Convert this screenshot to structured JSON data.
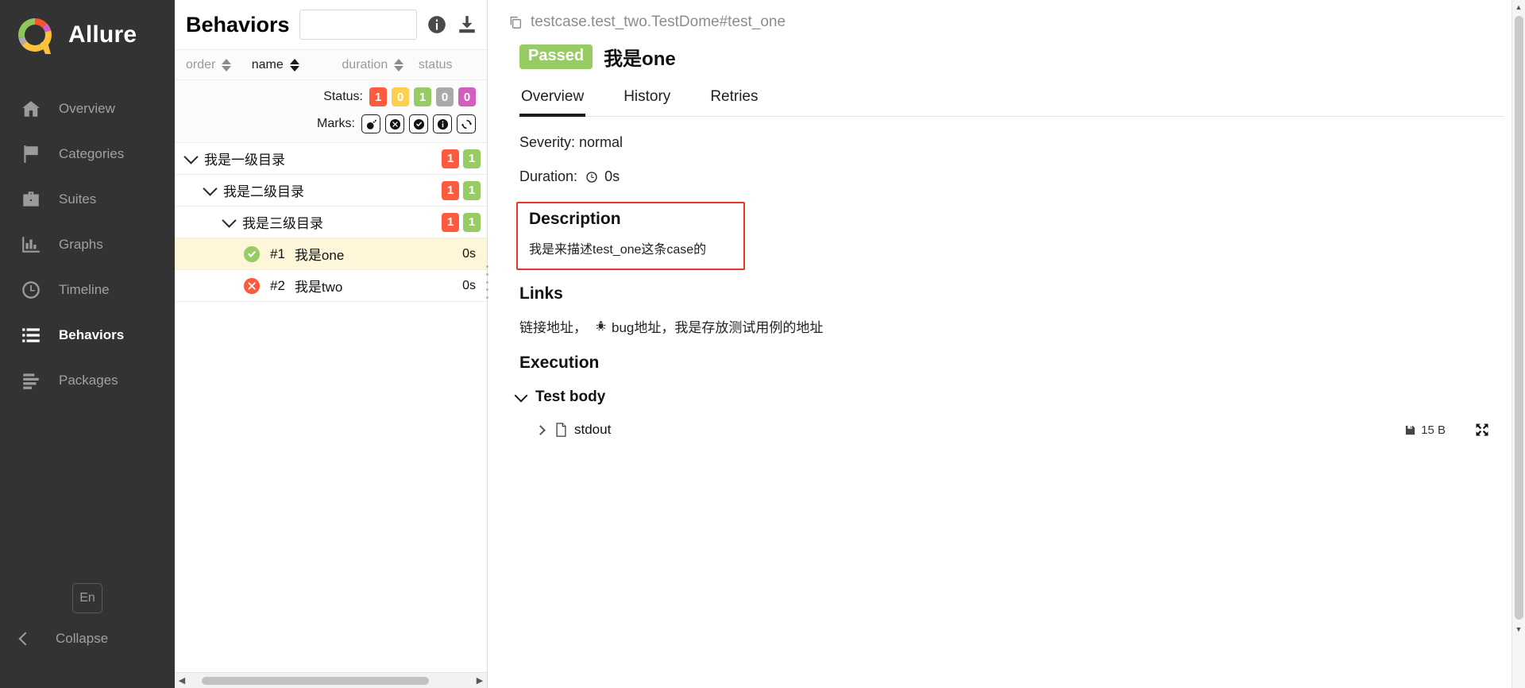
{
  "sidebar": {
    "brand": "Allure",
    "logo_icon": "allure-donut-logo",
    "items": [
      {
        "label": "Overview",
        "icon": "home-icon",
        "active": false
      },
      {
        "label": "Categories",
        "icon": "flag-icon",
        "active": false
      },
      {
        "label": "Suites",
        "icon": "briefcase-icon",
        "active": false
      },
      {
        "label": "Graphs",
        "icon": "bar-chart-icon",
        "active": false
      },
      {
        "label": "Timeline",
        "icon": "clock-icon",
        "active": false
      },
      {
        "label": "Behaviors",
        "icon": "list-icon",
        "active": true
      },
      {
        "label": "Packages",
        "icon": "layers-icon",
        "active": false
      }
    ],
    "language_button": "En",
    "collapse_label": "Collapse",
    "collapse_icon": "chevron-left-icon"
  },
  "tree_panel": {
    "title": "Behaviors",
    "search_value": "",
    "search_placeholder": "",
    "info_icon": "info-circle-icon",
    "download_icon": "download-icon",
    "columns": [
      {
        "label": "order",
        "sorted": false
      },
      {
        "label": "name",
        "sorted": true
      },
      {
        "label": "duration",
        "sorted": false
      },
      {
        "label": "status",
        "sorted": false
      }
    ],
    "status_filter_label": "Status:",
    "status_filters": [
      {
        "value": "1",
        "color": "#fd5a3e",
        "name": "failed"
      },
      {
        "value": "0",
        "color": "#ffd050",
        "name": "broken"
      },
      {
        "value": "1",
        "color": "#97cc64",
        "name": "passed"
      },
      {
        "value": "0",
        "color": "#aaaaaa",
        "name": "skipped"
      },
      {
        "value": "0",
        "color": "#d35ebe",
        "name": "unknown"
      }
    ],
    "marks_label": "Marks:",
    "marks": [
      {
        "icon": "bomb-icon",
        "name": "flaky-mark"
      },
      {
        "icon": "x-circle-icon",
        "name": "failed-mark"
      },
      {
        "icon": "check-circle-icon",
        "name": "passed-mark"
      },
      {
        "icon": "info-circle-icon",
        "name": "info-mark"
      },
      {
        "icon": "retry-icon",
        "name": "retry-mark"
      }
    ],
    "groups": [
      {
        "label": "我是一级目录",
        "level": 1,
        "badges": [
          {
            "value": "1",
            "color": "#fd5a3e"
          },
          {
            "value": "1",
            "color": "#97cc64"
          }
        ]
      },
      {
        "label": "我是二级目录",
        "level": 2,
        "badges": [
          {
            "value": "1",
            "color": "#fd5a3e"
          },
          {
            "value": "1",
            "color": "#97cc64"
          }
        ]
      },
      {
        "label": "我是三级目录",
        "level": 3,
        "badges": [
          {
            "value": "1",
            "color": "#fd5a3e"
          },
          {
            "value": "1",
            "color": "#97cc64"
          }
        ]
      }
    ],
    "tests": [
      {
        "order": "#1",
        "name": "我是one",
        "duration": "0s",
        "status": "passed",
        "selected": true
      },
      {
        "order": "#2",
        "name": "我是two",
        "duration": "0s",
        "status": "failed",
        "selected": false
      }
    ]
  },
  "detail": {
    "breadcrumb": "testcase.test_two.TestDome#test_one",
    "breadcrumb_icon": "copy-icon",
    "status_tag": "Passed",
    "status_tag_color": "#97cc64",
    "case_title": "我是one",
    "tabs": [
      {
        "label": "Overview",
        "active": true
      },
      {
        "label": "History",
        "active": false
      },
      {
        "label": "Retries",
        "active": false
      }
    ],
    "severity_line": "Severity: normal",
    "duration_label": "Duration:",
    "duration_value": "0s",
    "duration_icon": "clock-icon",
    "description_heading": "Description",
    "description_text": "我是来描述test_one这条case的",
    "description_border_color": "#e8352a",
    "links_heading": "Links",
    "links_text_before": "链接地址，",
    "links_bug_icon": "bug-icon",
    "links_text_after": "bug地址，我是存放测试用例的地址",
    "execution_heading": "Execution",
    "test_body_label": "Test body",
    "attachment": {
      "name": "stdout",
      "file_icon": "file-icon",
      "size": "15 B",
      "size_icon": "save-icon",
      "expand_icon": "expand-icon"
    }
  }
}
